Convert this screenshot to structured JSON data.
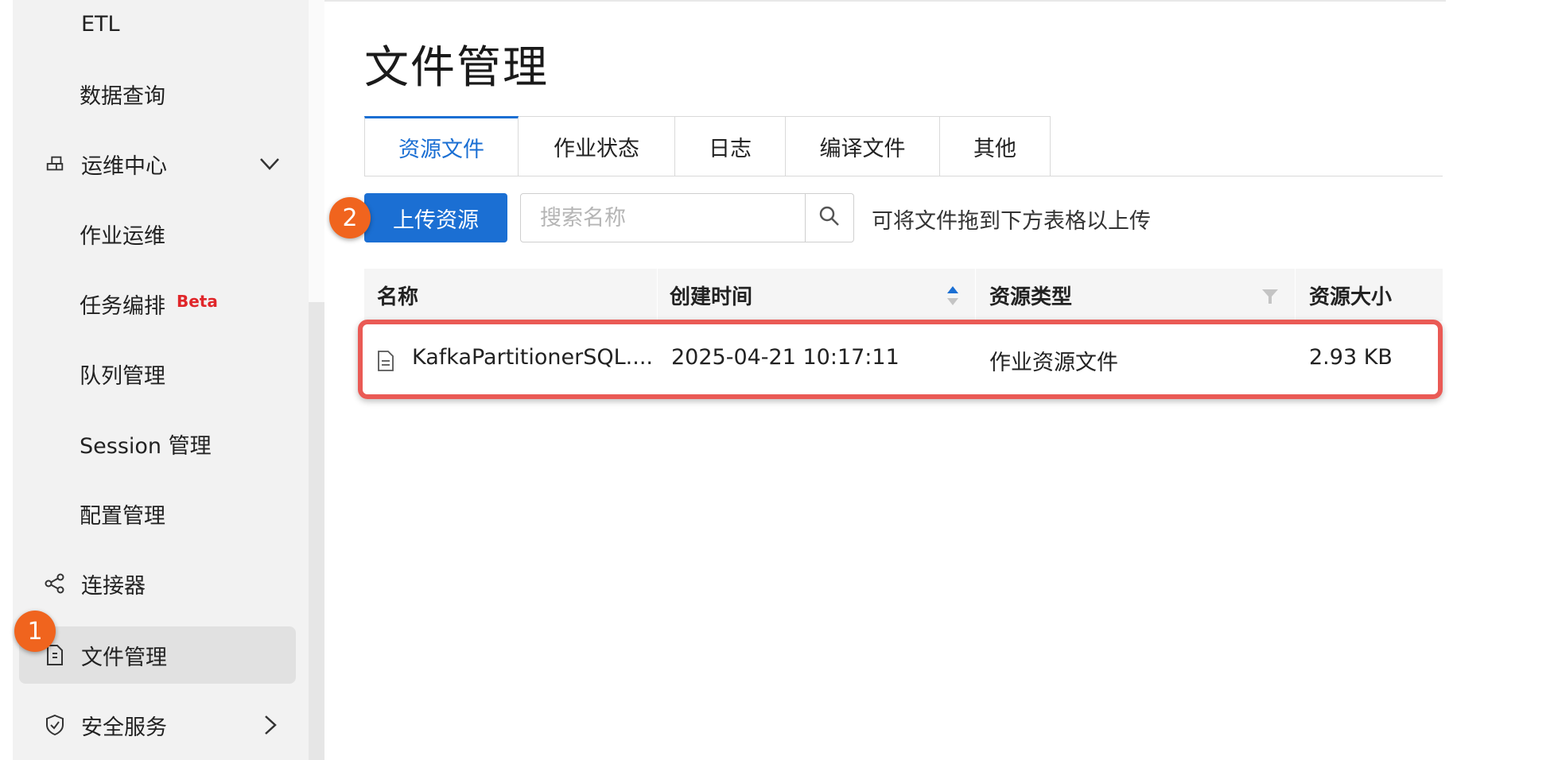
{
  "sidebar": {
    "items": [
      {
        "label": "ETL"
      },
      {
        "label": "数据查询"
      },
      {
        "label": "运维中心"
      },
      {
        "label": "作业运维"
      },
      {
        "label": "任务编排",
        "badge": "Beta"
      },
      {
        "label": "队列管理"
      },
      {
        "label": "Session 管理"
      },
      {
        "label": "配置管理"
      },
      {
        "label": "连接器"
      },
      {
        "label": "文件管理"
      },
      {
        "label": "安全服务"
      }
    ]
  },
  "page": {
    "title": "文件管理"
  },
  "tabs": [
    {
      "label": "资源文件",
      "active": true
    },
    {
      "label": "作业状态"
    },
    {
      "label": "日志"
    },
    {
      "label": "编译文件"
    },
    {
      "label": "其他"
    }
  ],
  "toolbar": {
    "upload_label": "上传资源",
    "search_placeholder": "搜索名称",
    "hint": "可将文件拖到下方表格以上传"
  },
  "table": {
    "columns": [
      "名称",
      "创建时间",
      "资源类型",
      "资源大小"
    ],
    "rows": [
      {
        "name": "KafkaPartitionerSQL....",
        "created": "2025-04-21 10:17:11",
        "type": "作业资源文件",
        "size": "2.93 KB"
      }
    ]
  },
  "annotations": {
    "step1": "1",
    "step2": "2"
  },
  "colors": {
    "accent": "#1b6fd3",
    "badge": "#f0641e",
    "highlight": "#ea5a55",
    "beta": "#e0262a"
  },
  "icons": [
    "grid-icon",
    "chevron-down-icon",
    "share-icon",
    "file-icon",
    "shield-icon",
    "chevron-right-icon",
    "search-icon",
    "sort-icon",
    "filter-icon"
  ]
}
